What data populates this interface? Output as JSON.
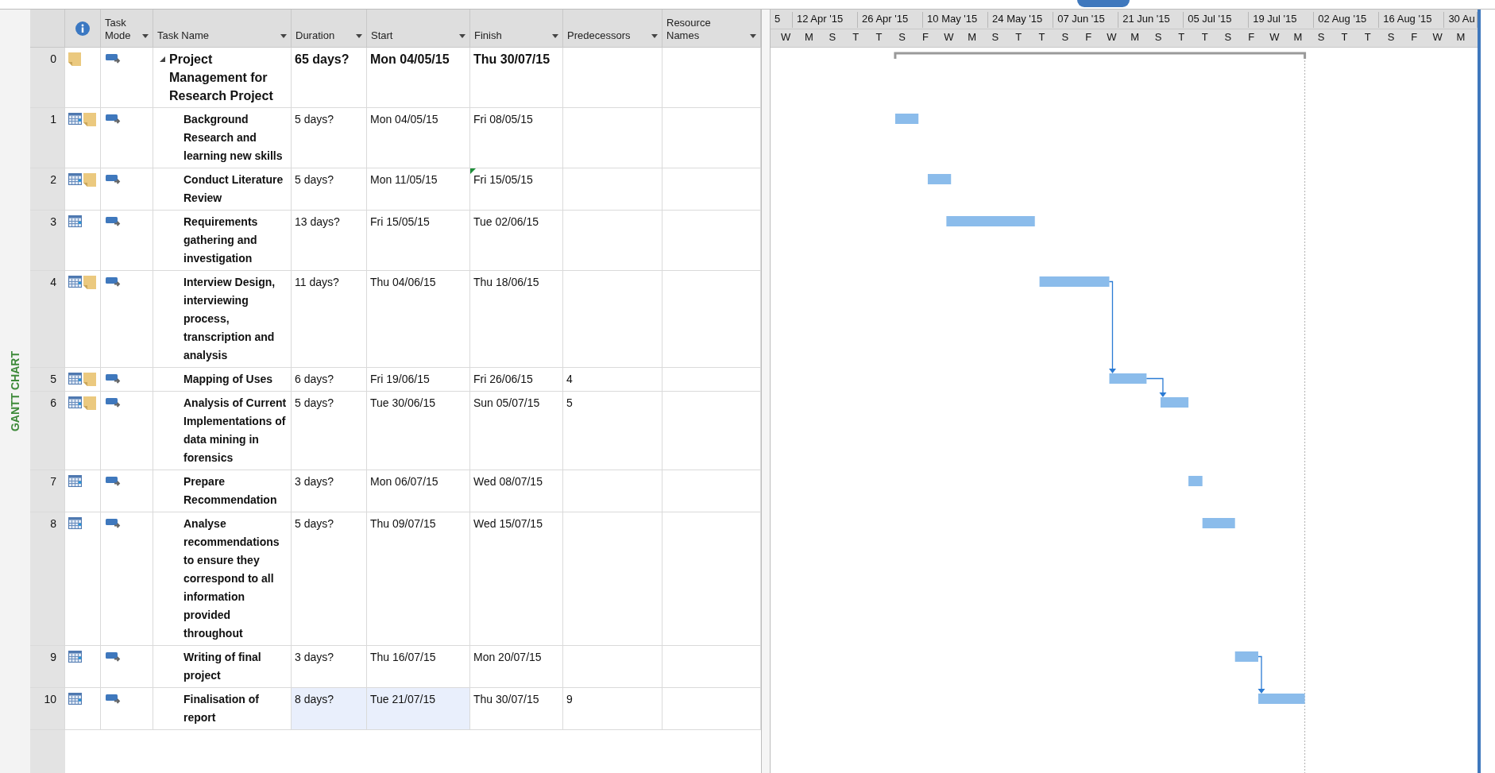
{
  "side_label": "GANTT CHART",
  "columns": [
    "Task Mode",
    "Task Name",
    "Duration",
    "Start",
    "Finish",
    "Predecessors",
    "Resource Names"
  ],
  "timescale": {
    "major": [
      "5",
      "12 Apr '15",
      "26 Apr '15",
      "10 May '15",
      "24 May '15",
      "07 Jun '15",
      "21 Jun '15",
      "05 Jul '15",
      "19 Jul '15",
      "02 Aug '15",
      "16 Aug '15",
      "30 Au"
    ],
    "minor": [
      "W",
      "M",
      "S",
      "T",
      "T",
      "S",
      "F",
      "W",
      "M",
      "S",
      "T",
      "T",
      "S",
      "F",
      "W",
      "M",
      "S",
      "T",
      "T",
      "S",
      "F",
      "W",
      "M",
      "S",
      "T",
      "T",
      "S",
      "F",
      "W",
      "M"
    ]
  },
  "tasks": [
    {
      "id": "0",
      "kind": "summary",
      "expanded": true,
      "calendar": false,
      "note": true,
      "name": "Project Management for Research Project",
      "duration": "65 days?",
      "start": "Mon 04/05/15",
      "finish": "Thu 30/07/15",
      "duration_selected": false,
      "start_selected": false,
      "finish_flagged": false,
      "children": [
        {
          "id": "1",
          "kind": "task",
          "calendar": true,
          "note": true,
          "name": "Background Research and learning new skills",
          "duration": "5 days?",
          "start": "Mon 04/05/15",
          "finish": "Fri 08/05/15",
          "duration_selected": false,
          "start_selected": false,
          "finish_flagged": false
        },
        {
          "id": "2",
          "kind": "task",
          "calendar": true,
          "note": true,
          "name": "Conduct Literature Review",
          "duration": "5 days?",
          "start": "Mon 11/05/15",
          "finish": "Fri 15/05/15",
          "duration_selected": false,
          "start_selected": false,
          "finish_flagged": true
        },
        {
          "id": "3",
          "kind": "task",
          "calendar": true,
          "note": false,
          "name": "Requirements gathering and investigation",
          "duration": "13 days?",
          "start": "Fri 15/05/15",
          "finish": "Tue 02/06/15",
          "duration_selected": false,
          "start_selected": false,
          "finish_flagged": false
        },
        {
          "id": "4",
          "kind": "task",
          "calendar": true,
          "note": true,
          "name": "Interview Design, interviewing process, transcription and analysis",
          "duration": "11 days?",
          "start": "Thu 04/06/15",
          "finish": "Thu 18/06/15",
          "duration_selected": false,
          "start_selected": false,
          "finish_flagged": false
        },
        {
          "id": "5",
          "kind": "task",
          "calendar": true,
          "note": true,
          "name": "Mapping of Uses",
          "duration": "6 days?",
          "start": "Fri 19/06/15",
          "finish": "Fri 26/06/15",
          "predecessors": "4",
          "duration_selected": false,
          "start_selected": false,
          "finish_flagged": false
        },
        {
          "id": "6",
          "kind": "task",
          "calendar": true,
          "note": true,
          "name": "Analysis of Current Implementations of data mining in forensics",
          "duration": "5 days?",
          "start": "Tue 30/06/15",
          "finish": "Sun 05/07/15",
          "predecessors": "5",
          "duration_selected": false,
          "start_selected": false,
          "finish_flagged": false
        },
        {
          "id": "7",
          "kind": "task",
          "calendar": true,
          "note": false,
          "name": "Prepare Recommendation",
          "duration": "3 days?",
          "start": "Mon 06/07/15",
          "finish": "Wed 08/07/15",
          "duration_selected": false,
          "start_selected": false,
          "finish_flagged": false
        },
        {
          "id": "8",
          "kind": "task",
          "calendar": true,
          "note": false,
          "name": "Analyse recommendations to ensure they correspond to all information provided throughout",
          "duration": "5 days?",
          "start": "Thu 09/07/15",
          "finish": "Wed 15/07/15",
          "duration_selected": false,
          "start_selected": false,
          "finish_flagged": false
        },
        {
          "id": "9",
          "kind": "task",
          "calendar": true,
          "note": false,
          "name": "Writing of final project",
          "duration": "3 days?",
          "start": "Thu 16/07/15",
          "finish": "Mon 20/07/15",
          "duration_selected": false,
          "start_selected": false,
          "finish_flagged": false
        },
        {
          "id": "10",
          "kind": "task",
          "calendar": true,
          "note": false,
          "name": "Finalisation of report",
          "duration": "8 days?",
          "start": "Tue 21/07/15",
          "finish": "Thu 30/07/15",
          "predecessors": "9",
          "duration_selected": true,
          "start_selected": true,
          "finish_flagged": false
        }
      ]
    }
  ]
}
